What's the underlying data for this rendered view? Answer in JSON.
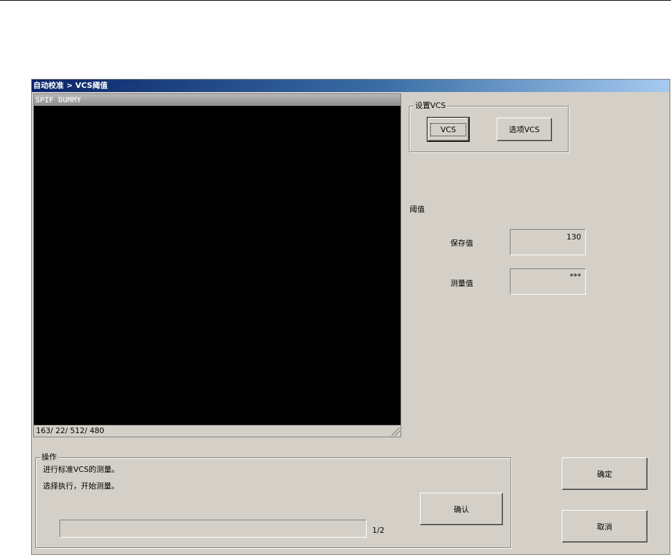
{
  "window": {
    "title": "自动校准 > VCS阈值"
  },
  "video": {
    "header": "SPIF DUMMY",
    "status": "163/ 22/ 512/ 480"
  },
  "vcs_group": {
    "label": "设置VCS",
    "vcs_button": "VCS",
    "option_vcs_button": "选项VCS"
  },
  "threshold": {
    "title": "阈值",
    "saved_label": "保存值",
    "saved_value": "130",
    "measured_label": "测量值",
    "measured_value": "***"
  },
  "operation": {
    "label": "操作",
    "line1": "进行标准VCS的测量。",
    "line2": "选择执行，开始测量。",
    "step": "1/2",
    "confirm_button": "确认",
    "progress": 0
  },
  "buttons": {
    "ok": "确定",
    "cancel": "取消"
  }
}
